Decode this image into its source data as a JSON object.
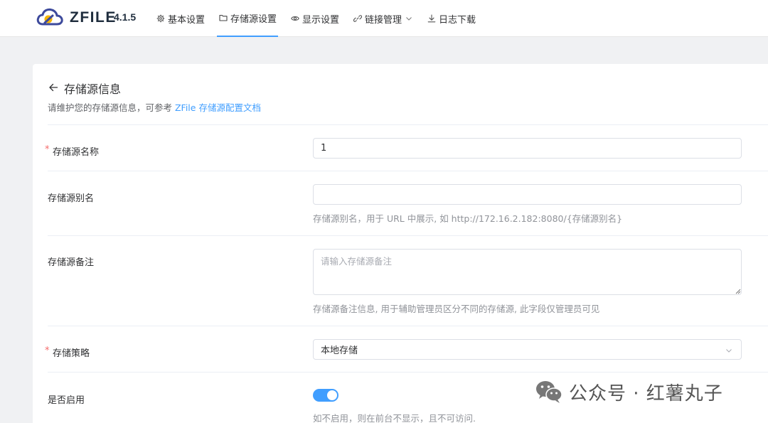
{
  "header": {
    "brand": "ZFILE",
    "version": "4.1.5",
    "nav": [
      {
        "label": "基本设置",
        "icon": "gear-icon"
      },
      {
        "label": "存储源设置",
        "icon": "folder-icon",
        "active": true
      },
      {
        "label": "显示设置",
        "icon": "eye-icon"
      },
      {
        "label": "链接管理",
        "icon": "link-icon",
        "has_dropdown": true
      },
      {
        "label": "日志下载",
        "icon": "download-icon"
      }
    ]
  },
  "card": {
    "title": "存储源信息",
    "subtitle_prefix": "请维护您的存储源信息，可参考 ",
    "subtitle_link": "ZFile 存储源配置文档"
  },
  "form": {
    "name": {
      "label": "存储源名称",
      "required_mark": "*",
      "value": "1"
    },
    "alias": {
      "label": "存储源别名",
      "value": "",
      "hint": "存储源别名，用于 URL 中展示, 如 http://172.16.2.182:8080/{存储源别名}"
    },
    "remark": {
      "label": "存储源备注",
      "placeholder": "请输入存储源备注",
      "hint": "存储源备注信息, 用于辅助管理员区分不同的存储源, 此字段仅管理员可见"
    },
    "strategy": {
      "label": "存储策略",
      "required_mark": "*",
      "value": "本地存储"
    },
    "enabled": {
      "label": "是否启用",
      "value": true,
      "hint": "如不启用，则在前台不显示，且不可访问."
    }
  },
  "watermark": {
    "text": "公众号 · 红薯丸子",
    "icon": "wechat-icon"
  },
  "colors": {
    "accent": "#409eff",
    "required": "#f56c6c"
  }
}
